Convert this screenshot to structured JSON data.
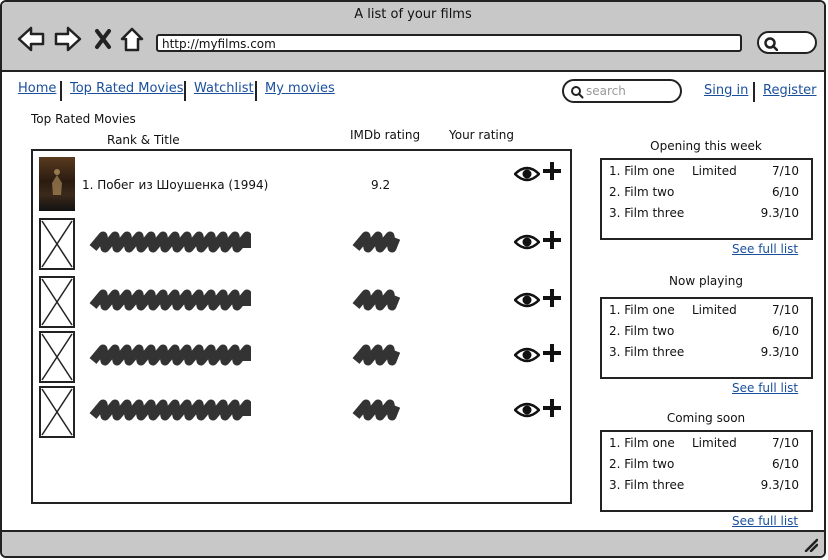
{
  "window": {
    "title": "A list of your films"
  },
  "browser": {
    "url": "http://myfilms.com"
  },
  "nav": {
    "home": "Home",
    "top_rated": "Top Rated Movies",
    "watchlist": "Watchlist",
    "my_movies": "My movies"
  },
  "search": {
    "placeholder": "search"
  },
  "auth": {
    "sign_in": "Sing in",
    "register": "Register"
  },
  "main": {
    "section_title": "Top Rated Movies",
    "col_rank_title": "Rank & Title",
    "col_imdb": "IMDb rating",
    "col_your": "Your rating",
    "first_row": {
      "title": "1. Побег из Шоушенка (1994)",
      "rating": "9.2"
    }
  },
  "panels": [
    {
      "title": "Opening this week",
      "rows": [
        {
          "title": "1. Film one",
          "status": "Limited",
          "rating": "7/10"
        },
        {
          "title": "2. Film two",
          "status": "",
          "rating": "6/10"
        },
        {
          "title": "3. Film three",
          "status": "",
          "rating": "9.3/10"
        }
      ],
      "link": "See full list"
    },
    {
      "title": "Now playing",
      "rows": [
        {
          "title": "1. Film one",
          "status": "Limited",
          "rating": "7/10"
        },
        {
          "title": "2. Film two",
          "status": "",
          "rating": "6/10"
        },
        {
          "title": "3. Film three",
          "status": "",
          "rating": "9.3/10"
        }
      ],
      "link": "See full list"
    },
    {
      "title": "Coming soon",
      "rows": [
        {
          "title": "1. Film one",
          "status": "Limited",
          "rating": "7/10"
        },
        {
          "title": "2. Film two",
          "status": "",
          "rating": "6/10"
        },
        {
          "title": "3. Film three",
          "status": "",
          "rating": "9.3/10"
        }
      ],
      "link": "See full list"
    }
  ],
  "icons": [
    "back-icon",
    "forward-icon",
    "close-icon",
    "home-icon",
    "search-icon",
    "eye-icon",
    "plus-icon",
    "resize-grip-icon"
  ]
}
